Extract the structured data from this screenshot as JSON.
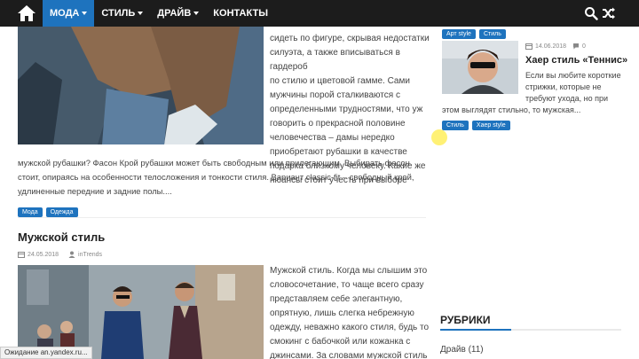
{
  "nav": {
    "items": [
      {
        "label": "МОДА",
        "active": true,
        "dropdown": true
      },
      {
        "label": "СТИЛЬ",
        "active": false,
        "dropdown": true
      },
      {
        "label": "ДРАЙВ",
        "active": false,
        "dropdown": true
      },
      {
        "label": "КОНТАКТЫ",
        "active": false,
        "dropdown": false
      }
    ]
  },
  "post1": {
    "right_lines": [
      "сидеть по фигуре, скрывая недостатки",
      "силуэта, а также вписываться в гардероб",
      "по стилю и цветовой гамме. Сами",
      "мужчины порой сталкиваются с",
      "определенными трудностями, что уж",
      "говорить о прекрасной половине",
      "человечества – дамы нередко",
      "приобретают рубашки в качестве",
      "подарка близкому человеку. Какие же",
      "нюансы стоит учесть при выборе"
    ],
    "full_lines": [
      "мужской рубашки?   Фасон Крой рубашки может быть свободным или прилегающим. Выбирать фасон",
      "стоит, опираясь на особенности телосложения и тонкости стиля. Вариант classic-fit – свободный крой,",
      "удлиненные передние и задние полы...."
    ],
    "tags": [
      "Мода",
      "Одежда"
    ]
  },
  "post2": {
    "title": "Мужской стиль",
    "date": "24.05.2018",
    "author": "inTrends",
    "right_lines": [
      "Мужской стиль. Когда мы слышим это",
      "словосочетание, то чаще всего сразу",
      "представляем себе элегантную,",
      "опрятную, лишь слегка небрежную",
      "одежду, неважно какого стиля, будь то",
      "смокинг с бабочкой или кожанка с",
      "джинсами. За словами мужской стиль"
    ]
  },
  "sidebar": {
    "top_tags": [
      "Арт style",
      "Стиль"
    ],
    "post": {
      "date": "14.06.2018",
      "comments": "0",
      "title": "Хаер стиль «Теннис»",
      "lines": [
        "Если вы любите короткие",
        "стрижки, которые не",
        "требуют ухода, но при"
      ],
      "wide_line": "этом выглядят стильно, то мужская...",
      "tags": [
        "Стиль",
        "Хаер style"
      ]
    },
    "section_title": "РУБРИКИ",
    "categories": [
      {
        "label": "Драйв (11)"
      }
    ]
  },
  "status_text": "Ожидание an.yandex.ru...",
  "colors": {
    "accent": "#1e73be",
    "topbar": "#1c1c1c"
  }
}
